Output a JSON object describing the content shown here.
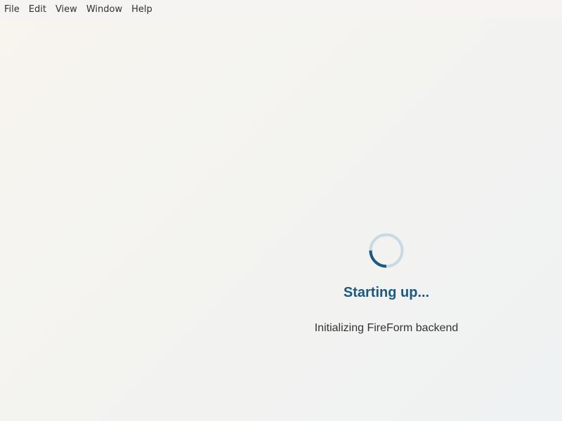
{
  "menu": {
    "items": [
      {
        "label": "File"
      },
      {
        "label": "Edit"
      },
      {
        "label": "View"
      },
      {
        "label": "Window"
      },
      {
        "label": "Help"
      }
    ]
  },
  "loader": {
    "title": "Starting up...",
    "message": "Initializing FireForm backend",
    "accent_color": "#1b5a80",
    "track_color": "#c9d9e1"
  }
}
